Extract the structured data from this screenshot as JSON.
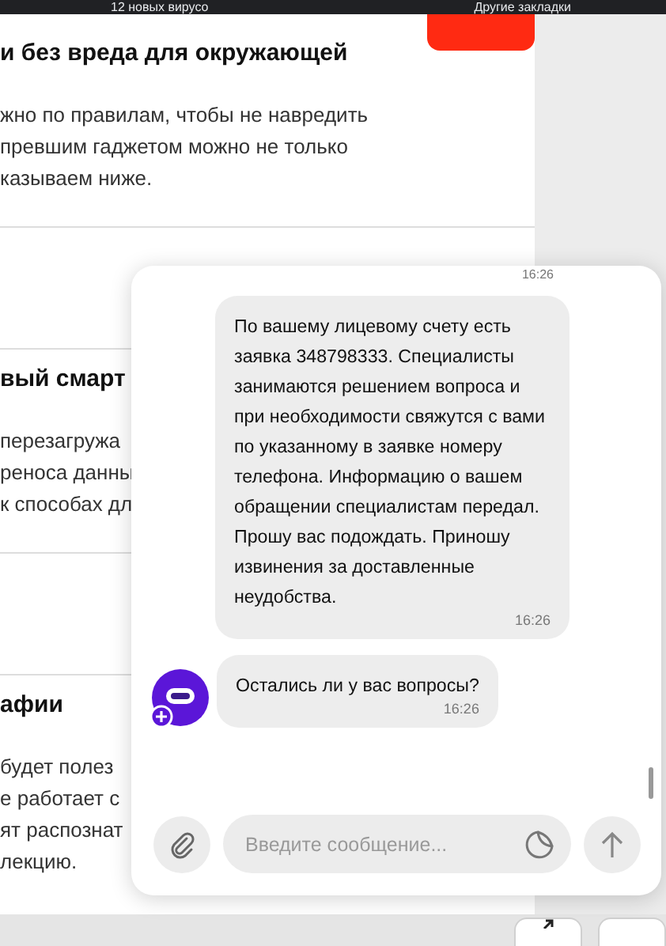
{
  "bookmarks": [
    {
      "label": "12 новых вирусо"
    },
    {
      "label": "Другие закладки"
    }
  ],
  "article": [
    {
      "kind": "section",
      "heading": "и без вреда для окружающей",
      "lines": [
        "жно по правилам, чтобы не навредить",
        "превшим гаджетом можно не только",
        "казываем ниже."
      ]
    },
    {
      "kind": "divider"
    },
    {
      "kind": "gap"
    },
    {
      "kind": "divider"
    },
    {
      "kind": "section",
      "heading": "вый смарт",
      "lines": [
        "перезагружа",
        "реноса данны",
        "к способах дл"
      ]
    },
    {
      "kind": "divider"
    },
    {
      "kind": "gap"
    },
    {
      "kind": "divider"
    },
    {
      "kind": "section",
      "heading": "афии",
      "lines": [
        "будет полез",
        "е работает с",
        "ят распознат",
        "лекцию."
      ]
    }
  ],
  "chat": {
    "cut_time": "16:26",
    "messages": [
      {
        "text": "По вашему лицевому счету есть заявка 348798333. Специалисты занимаются решением вопроса и при необходимости свяжутся с вами по указанному в заявке номеру телефона. Информацию о вашем обращении специалистам передал. Прошу вас подождать. Приношу извинения за доставленные неудобства.",
        "time": "16:26",
        "show_avatar": false
      },
      {
        "text": "Остались ли у вас вопросы?",
        "time": "16:26",
        "show_avatar": true
      }
    ],
    "input": {
      "placeholder": "Введите сообщение..."
    }
  }
}
